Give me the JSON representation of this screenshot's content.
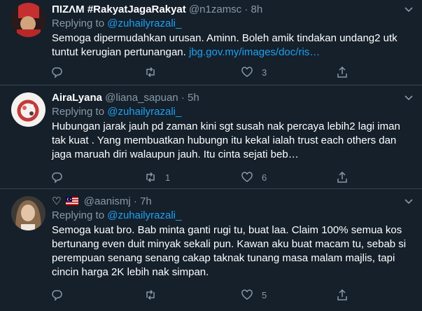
{
  "tweets": [
    {
      "display_name": "ΠIZΛM #RakyatJagaRakyat",
      "handle": "@n1zamsc",
      "dot": "·",
      "time": "8h",
      "replying_prefix": "Replying to ",
      "replying_to": "@zuhailyrazali_",
      "text": "Semoga dipermudahkan urusan. Aminn. Boleh amik tindakan undang2 utk tuntut kerugian pertunangan. ",
      "link": "jbg.gov.my/images/doc/ris…",
      "replies": "",
      "retweets": "",
      "likes": "3"
    },
    {
      "display_name": "AiraLyana",
      "handle": "@liana_sapuan",
      "dot": "·",
      "time": "5h",
      "replying_prefix": "Replying to ",
      "replying_to": "@zuhailyrazali_",
      "text": "Hubungan jarak jauh pd zaman kini sgt susah nak percaya lebih2 lagi iman tak kuat . Yang membuatkan hubungn itu kekal ialah trust each others dan jaga maruah diri walaupun jauh. Itu cinta sejati beb…",
      "replies": "",
      "retweets": "1",
      "likes": "6"
    },
    {
      "display_name": "♡",
      "handle": "@aanismj",
      "dot": "·",
      "time": "7h",
      "replying_prefix": "Replying to ",
      "replying_to": "@zuhailyrazali_",
      "text": "Semoga kuat bro. Bab minta ganti rugi tu, buat laa. Claim 100% semua kos bertunang even duit minyak sekali pun. Kawan aku buat macam tu, sebab si perempuan senang senang cakap taknak tunang masa malam majlis, tapi cincin harga 2K lebih nak simpan.",
      "replies": "",
      "retweets": "",
      "likes": "5"
    }
  ],
  "colors": {
    "background": "#15202b",
    "secondary_text": "#8899a6",
    "accent": "#1da1f2",
    "divider": "#38444d"
  },
  "icons": {
    "reply": "reply-icon",
    "retweet": "retweet-icon",
    "like": "heart-icon",
    "share": "share-icon",
    "more": "chevron-down-icon"
  }
}
